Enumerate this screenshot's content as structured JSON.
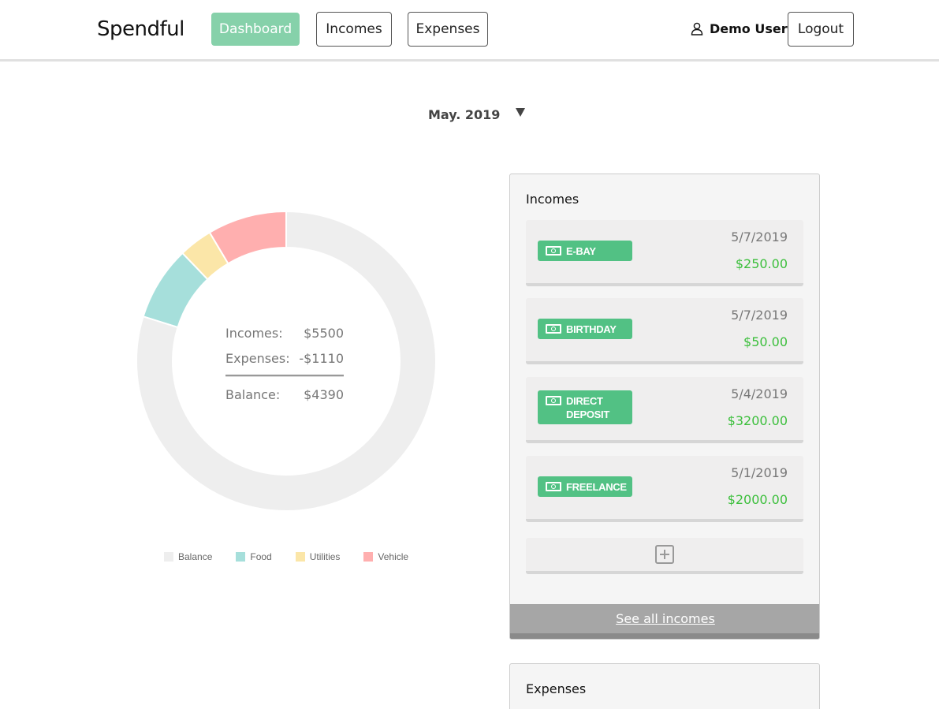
{
  "header": {
    "brand": "Spendful",
    "nav": [
      {
        "label": "Dashboard",
        "active": true
      },
      {
        "label": "Incomes",
        "active": false
      },
      {
        "label": "Expenses",
        "active": false
      }
    ],
    "user_name": "Demo User",
    "logout_label": "Logout",
    "user_icon": "user-outline-icon"
  },
  "month_selector": {
    "label": "May. 2019",
    "icon": "caret-down-icon"
  },
  "summary": {
    "incomes_label": "Incomes:",
    "incomes_value": "$5500",
    "expenses_label": "Expenses:",
    "expenses_value": "-$1110",
    "balance_label": "Balance:",
    "balance_value": "$4390"
  },
  "chart_data": {
    "type": "pie",
    "style": "donut",
    "categories": [
      "Balance",
      "Food",
      "Utilities",
      "Vehicle"
    ],
    "values": [
      4390,
      440,
      200,
      470
    ],
    "colors": [
      "#eeeeee",
      "#a6dfdb",
      "#fbe6a8",
      "#ffafaf"
    ],
    "legend_position": "bottom"
  },
  "incomes": {
    "title": "Incomes",
    "items": [
      {
        "name": "E-BAY",
        "date": "5/7/2019",
        "amount": "$250.00"
      },
      {
        "name": "BIRTHDAY",
        "date": "5/7/2019",
        "amount": "$50.00"
      },
      {
        "name": "DIRECT DEPOSIT",
        "date": "5/4/2019",
        "amount": "$3200.00"
      },
      {
        "name": "FREELANCE",
        "date": "5/1/2019",
        "amount": "$2000.00"
      }
    ],
    "add_icon": "plus-square-icon",
    "item_icon": "money-bill-icon",
    "see_all_label": "See all incomes"
  },
  "expenses": {
    "title": "Expenses"
  },
  "colors": {
    "accent": "#86d1aa",
    "tag": "#52c184",
    "amount": "#3cbf3c"
  }
}
